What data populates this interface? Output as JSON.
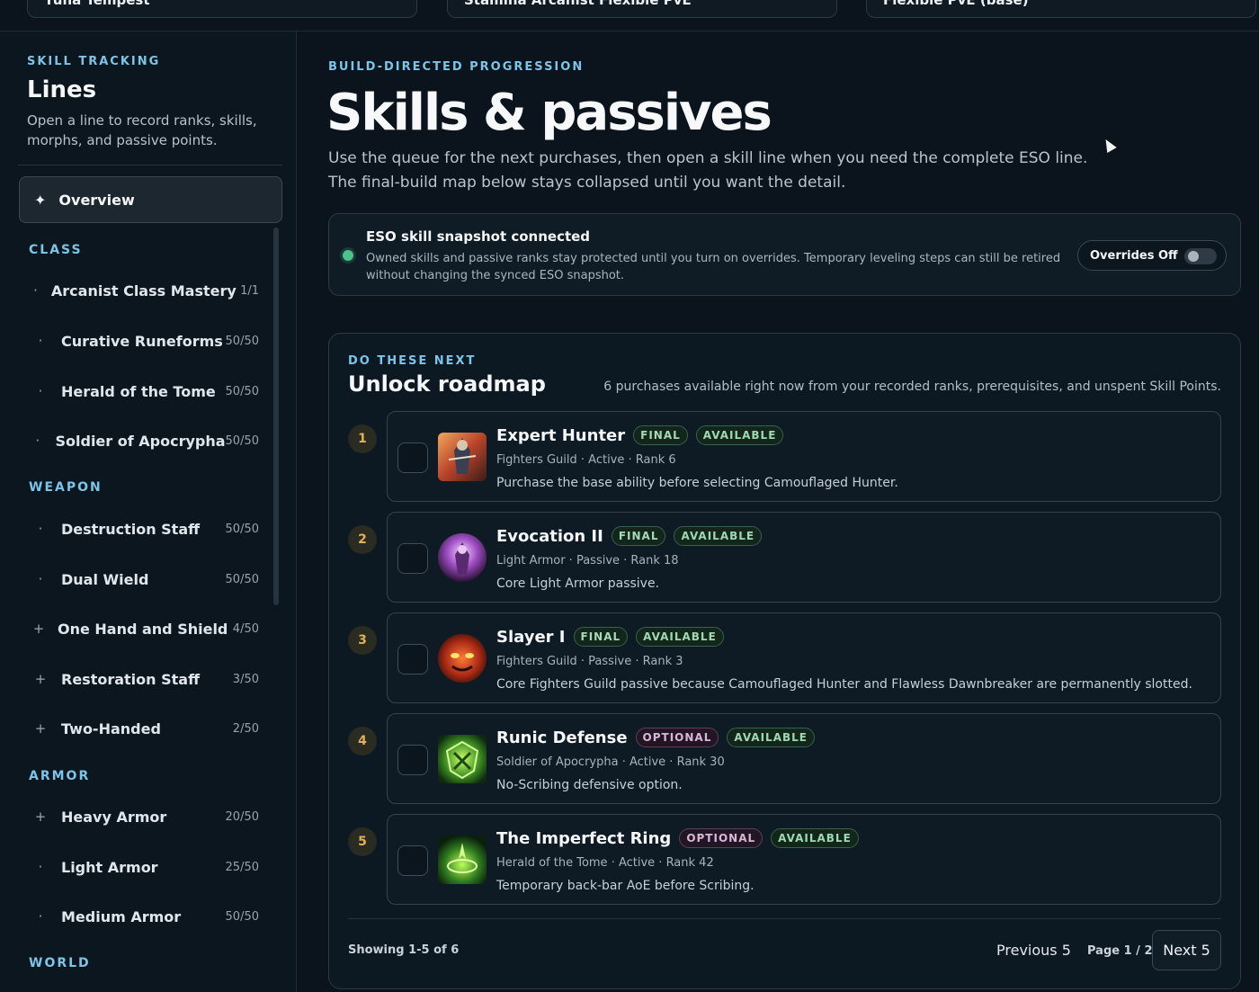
{
  "topbar": {
    "selects": [
      "Yuna Tempest",
      "Stamina Arcanist Flexible PvE",
      "Flexible PvE (base)"
    ]
  },
  "sidebar": {
    "eyebrow": "SKILL TRACKING",
    "title": "Lines",
    "description": "Open a line to record ranks, skills, morphs, and passive points.",
    "overview": {
      "icon": "sparkle-icon",
      "label": "Overview"
    },
    "categories": [
      {
        "label": "CLASS",
        "items": [
          {
            "mark": "·",
            "name": "Arcanist Class Mastery",
            "count": "1/1"
          },
          {
            "mark": "·",
            "name": "Curative Runeforms",
            "count": "50/50"
          },
          {
            "mark": "·",
            "name": "Herald of the Tome",
            "count": "50/50"
          },
          {
            "mark": "·",
            "name": "Soldier of Apocrypha",
            "count": "50/50"
          }
        ]
      },
      {
        "label": "WEAPON",
        "items": [
          {
            "mark": "·",
            "name": "Destruction Staff",
            "count": "50/50"
          },
          {
            "mark": "·",
            "name": "Dual Wield",
            "count": "50/50"
          },
          {
            "mark": "+",
            "name": "One Hand and Shield",
            "count": "4/50"
          },
          {
            "mark": "+",
            "name": "Restoration Staff",
            "count": "3/50"
          },
          {
            "mark": "+",
            "name": "Two-Handed",
            "count": "2/50"
          }
        ]
      },
      {
        "label": "ARMOR",
        "items": [
          {
            "mark": "+",
            "name": "Heavy Armor",
            "count": "20/50"
          },
          {
            "mark": "·",
            "name": "Light Armor",
            "count": "25/50"
          },
          {
            "mark": "·",
            "name": "Medium Armor",
            "count": "50/50"
          }
        ]
      },
      {
        "label": "WORLD",
        "items": []
      }
    ]
  },
  "main": {
    "eyebrow": "BUILD-DIRECTED PROGRESSION",
    "title": "Skills & passives",
    "description": "Use the queue for the next purchases, then open a skill line when you need the complete ESO line. The final-build map below stays collapsed until you want the detail.",
    "snapshot": {
      "title": "ESO skill snapshot connected",
      "text": "Owned skills and passive ranks stay protected until you turn on overrides. Temporary leveling steps can still be retired without changing the synced ESO snapshot.",
      "override_label": "Overrides Off"
    },
    "roadmap": {
      "eyebrow": "DO THESE NEXT",
      "title": "Unlock roadmap",
      "summary": "6 purchases available right now from your recorded ranks, prerequisites, and unspent Skill Points.",
      "items": [
        {
          "num": "1",
          "name": "Expert Hunter",
          "badges": [
            "FINAL",
            "AVAILABLE"
          ],
          "meta": "Fighters Guild · Active · Rank 6",
          "note": "Purchase the base ability before selecting Camouflaged Hunter.",
          "icon": "expert-hunter-icon"
        },
        {
          "num": "2",
          "name": "Evocation II",
          "badges": [
            "FINAL",
            "AVAILABLE"
          ],
          "meta": "Light Armor · Passive · Rank 18",
          "note": "Core Light Armor passive.",
          "icon": "evocation-icon"
        },
        {
          "num": "3",
          "name": "Slayer I",
          "badges": [
            "FINAL",
            "AVAILABLE"
          ],
          "meta": "Fighters Guild · Passive · Rank 3",
          "note": "Core Fighters Guild passive because Camouflaged Hunter and Flawless Dawnbreaker are permanently slotted.",
          "icon": "slayer-icon"
        },
        {
          "num": "4",
          "name": "Runic Defense",
          "badges": [
            "OPTIONAL",
            "AVAILABLE"
          ],
          "meta": "Soldier of Apocrypha · Active · Rank 30",
          "note": "No-Scribing defensive option.",
          "icon": "runic-defense-icon"
        },
        {
          "num": "5",
          "name": "The Imperfect Ring",
          "badges": [
            "OPTIONAL",
            "AVAILABLE"
          ],
          "meta": "Herald of the Tome · Active · Rank 42",
          "note": "Temporary back-bar AoE before Scribing.",
          "icon": "imperfect-ring-icon"
        }
      ],
      "showing": "Showing 1-5 of 6",
      "prev_label": "Previous 5",
      "page_label": "Page 1 / 2",
      "next_label": "Next 5"
    }
  },
  "colors": {
    "accent": "#7cc4e8",
    "success": "#4cc38a",
    "step": "#e0b15a",
    "background": "#0b141c"
  }
}
